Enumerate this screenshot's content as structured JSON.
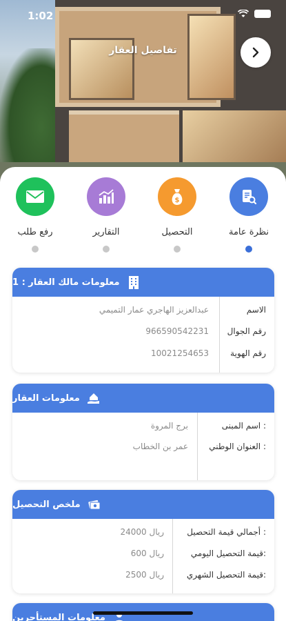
{
  "status_bar": {
    "time": "1:02"
  },
  "header": {
    "title": "تفاصيل العقار",
    "back_icon": "chevron-right-icon"
  },
  "tabs": [
    {
      "label": "نظرة عامة",
      "color": "#4a7ee0",
      "icon": "document-search-icon",
      "active": true
    },
    {
      "label": "التحصيل",
      "color": "#f59a2f",
      "icon": "money-bag-icon",
      "active": false
    },
    {
      "label": "التقارير",
      "color": "#a77bd6",
      "icon": "bar-chart-icon",
      "active": false
    },
    {
      "label": "رفع طلب",
      "color": "#1fc15b",
      "icon": "envelope-icon",
      "active": false
    }
  ],
  "owner_card": {
    "title": "معلومات مالك العقار : 1",
    "icon": "building-icon",
    "rows": [
      {
        "key": "الاسم",
        "value": "عبدالعزيز الهاجري عمار التميمي"
      },
      {
        "key": "رقم الجوال",
        "value": "966590542231"
      },
      {
        "key": "رقم الهوية",
        "value": "10021254653"
      }
    ]
  },
  "property_card": {
    "title": "معلومات العقار",
    "icon": "house-hand-icon",
    "rows": [
      {
        "key": "اسم المبنى :",
        "value": "برج المروة"
      },
      {
        "key": "العنوان الوطني :",
        "value": "عمر بن الخطاب"
      }
    ]
  },
  "collection_card": {
    "title": "ملخص التحصيل",
    "icon": "cash-icon",
    "rows": [
      {
        "key": "أجمالي قيمة التحصيل :",
        "value": "24000 ريال"
      },
      {
        "key": "قيمة التحصيل اليومي:",
        "value": "600 ريال"
      },
      {
        "key": "قيمة التحصيل الشهري:",
        "value": "2500 ريال"
      }
    ]
  },
  "tenants_card": {
    "title": "معلومات المستأجرين",
    "icon": "person-icon"
  },
  "colors": {
    "accent": "#4a7ee0",
    "active_dot": "#3b6fd8"
  }
}
